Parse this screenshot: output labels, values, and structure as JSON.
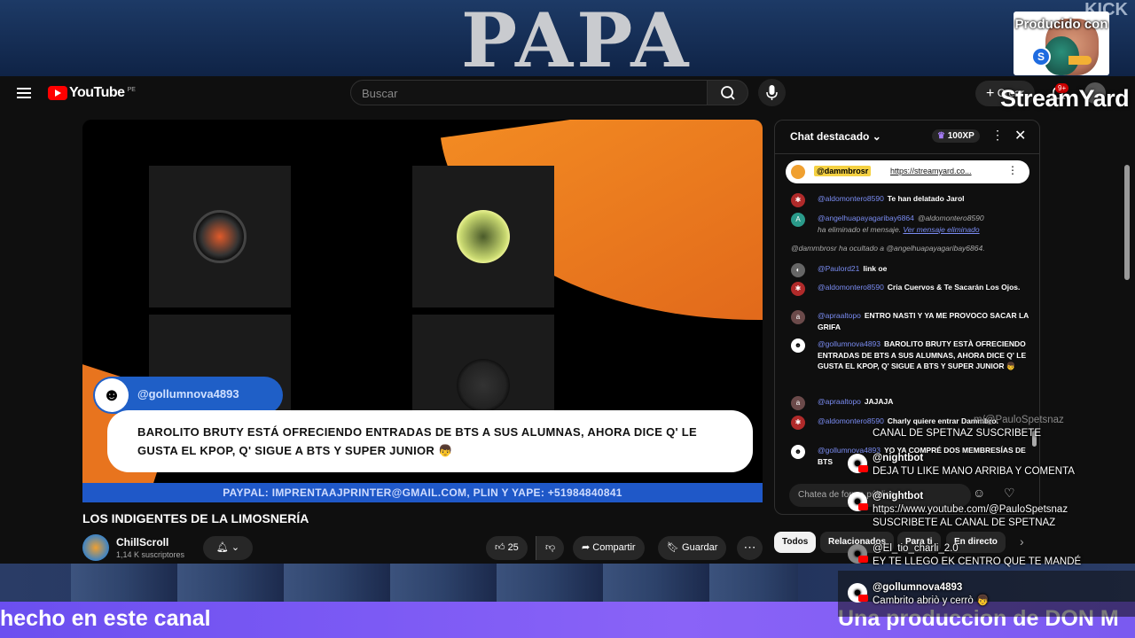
{
  "background": {
    "banner_title": "PAPA",
    "corner_text": "KICK",
    "producido": "Producido con",
    "producido_badge": "S",
    "streamyard_brand": "StreamYard"
  },
  "header": {
    "logo": "YouTube",
    "country": "PE",
    "search_placeholder": "Buscar",
    "create_label": "Crear",
    "notifications_count": "9+"
  },
  "player": {
    "lower_third_name": "@gollumnova4893",
    "lower_third_message": "BAROLITO BRUTY ESTÁ OFRECIENDO ENTRADAS DE BTS A SUS ALUMNAS, AHORA DICE Q' LE GUSTA EL KPOP, Q' SIGUE A BTS Y SUPER JUNIOR 👦",
    "paypal_bar": "PAYPAL: IMPRENTAAJPRINTER@GMAIL.COM, PLIN Y YAPE: +51984840841"
  },
  "video": {
    "title": "LOS INDIGENTES DE LA LIMOSNERÍA",
    "channel_name": "ChillScroll",
    "subscribers": "1,14 K suscriptores",
    "likes": "25",
    "share": "Compartir",
    "save": "Guardar"
  },
  "chat": {
    "title": "Chat destacado",
    "xp": "100XP",
    "pinned_user": "@dammbrosr",
    "pinned_link": "https://streamyard.co...",
    "messages": [
      {
        "user": "@aldomontero8590",
        "text": "Te han delatado Jarol"
      },
      {
        "user": "@angelhuapayagaribay6864",
        "text": "@aldomontero8590",
        "sys": "ha eliminado el mensaje.",
        "link": "Ver mensaje eliminado"
      },
      {
        "sys": "@dammbrosr ha ocultado a @angelhuapayagaribay6864."
      },
      {
        "user": "@Paulord21",
        "text": "link oe"
      },
      {
        "user": "@aldomontero8590",
        "text": "Cria Cuervos & Te Sacarán Los Ojos."
      },
      {
        "user": "@apraaltopo",
        "text": "ENTRO NASTI Y YA ME PROVOCO SACAR LA GRIFA"
      },
      {
        "user": "@gollumnova4893",
        "text": "BAROLITO BRUTY ESTÀ OFRECIENDO ENTRADAS DE BTS A SUS ALUMNAS, AHORA DICE Q' LE GUSTA EL KPOP, Q' SIGUE A BTS Y SUPER JUNIOR 👦"
      },
      {
        "user": "@apraaltopo",
        "text": "JAJAJA"
      },
      {
        "user": "@aldomontero8590",
        "text": "Charly quiere entrar Dammbro."
      },
      {
        "user": "@gollumnova4893",
        "text": "YO YA COMPRÉ DOS MEMBRESÍAS DE BTS"
      }
    ],
    "input_placeholder": "Chatea de forma pública...",
    "avatar_letters": [
      "A",
      "a",
      "a"
    ]
  },
  "chips": [
    "Todos",
    "Relacionados",
    "Para ti",
    "En directo"
  ],
  "overlay_comments": [
    {
      "name": "",
      "text": "CANAL DE SPETNAZ SUSCRIBETE"
    },
    {
      "name": "@nightbot",
      "text": "DEJA TU LIKE MANO ARRIBA Y COMENTA"
    },
    {
      "name": "@nightbot",
      "text": "https://www.youtube.com/@PauloSpetsnaz SUSCRIBETE AL CANAL DE SPETNAZ"
    },
    {
      "name": "@El_tio_charli_2.0",
      "text": "EY TE LLEGO EK CENTRO QUE TE MANDÉ"
    },
    {
      "name": "@gollumnova4893",
      "text": "Cambrito abriò y cerrò 👦"
    }
  ],
  "overlay_ghost_link": "m/@PauloSpetsnaz",
  "ticker": {
    "left": "hecho en este canal",
    "right": "Una produccion de DON M"
  }
}
